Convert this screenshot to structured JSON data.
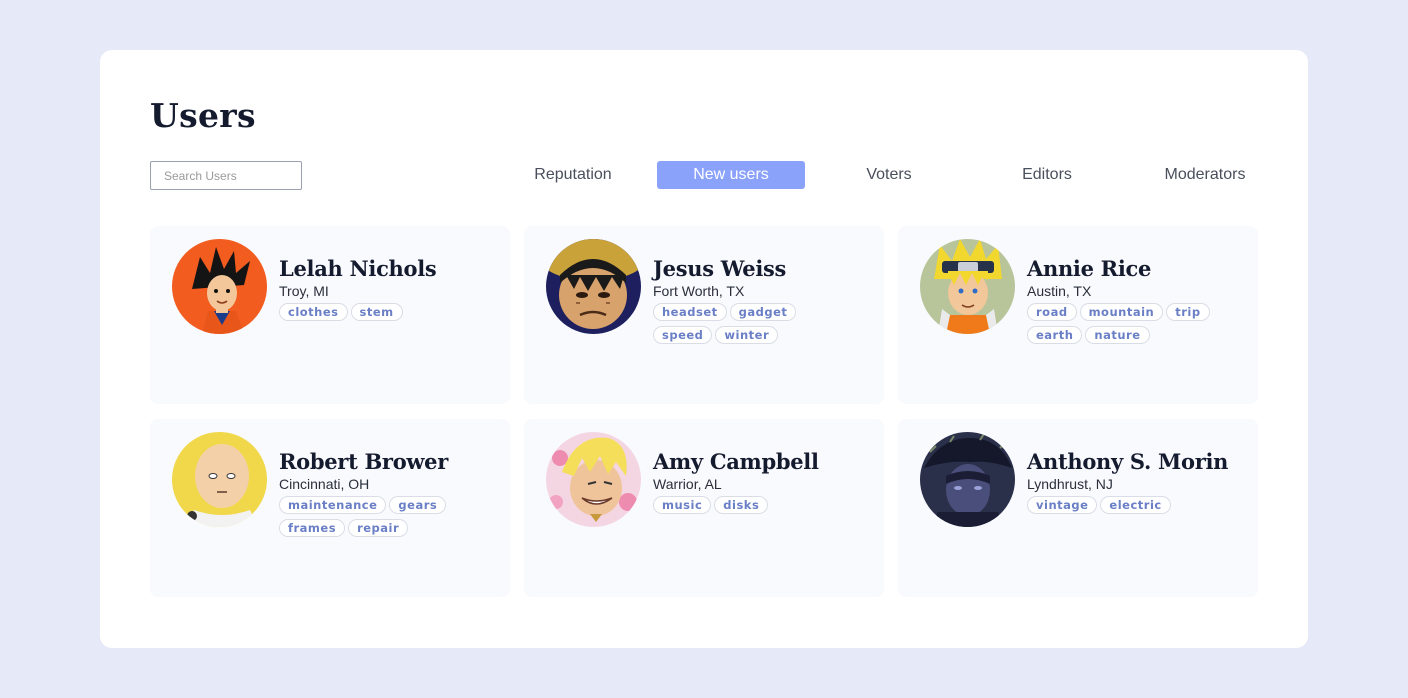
{
  "page": {
    "title": "Users"
  },
  "search": {
    "placeholder": "Search Users",
    "value": ""
  },
  "tabs": [
    {
      "label": "Reputation",
      "active": false
    },
    {
      "label": "New users",
      "active": true
    },
    {
      "label": "Voters",
      "active": false
    },
    {
      "label": "Editors",
      "active": false
    },
    {
      "label": "Moderators",
      "active": false
    }
  ],
  "colors": {
    "background": "#e6e9f7",
    "accent": "#8ba2fb",
    "tag_text": "#6a7fc6",
    "card": "#f9fafe"
  },
  "users": [
    {
      "name": "Lelah Nichols",
      "location": "Troy, MI",
      "tags": [
        "clothes",
        "stem"
      ],
      "avatar": "goku-avatar"
    },
    {
      "name": "Jesus Weiss",
      "location": "Fort Worth, TX",
      "tags": [
        "headset",
        "gadget",
        "speed",
        "winter"
      ],
      "avatar": "luffy-avatar"
    },
    {
      "name": "Annie Rice",
      "location": "Austin, TX",
      "tags": [
        "road",
        "mountain",
        "trip",
        "earth",
        "nature"
      ],
      "avatar": "naruto-avatar"
    },
    {
      "name": "Robert Brower",
      "location": "Cincinnati, OH",
      "tags": [
        "maintenance",
        "gears",
        "frames",
        "repair"
      ],
      "avatar": "saitama-avatar"
    },
    {
      "name": "Amy Campbell",
      "location": "Warrior, AL",
      "tags": [
        "music",
        "disks"
      ],
      "avatar": "sanji-avatar"
    },
    {
      "name": "Anthony S. Morin",
      "location": "Lyndhrust, NJ",
      "tags": [
        "vintage",
        "electric"
      ],
      "avatar": "jotaro-avatar"
    }
  ]
}
